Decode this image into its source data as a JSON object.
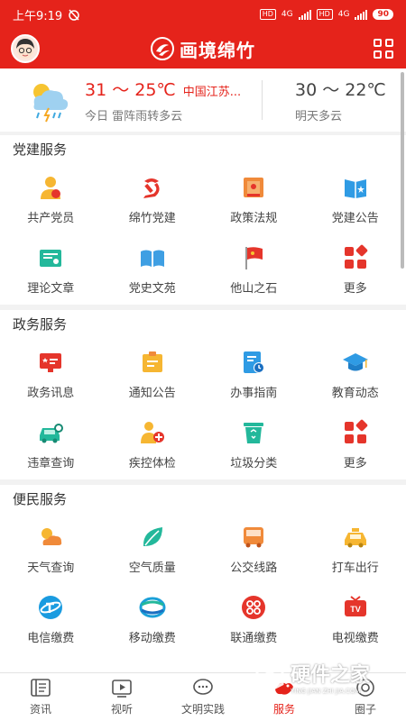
{
  "status_bar": {
    "time": "上午9:19",
    "signal_1": "4G",
    "signal_2": "4G",
    "hd_1": "HD",
    "hd_2": "HD",
    "battery": "90"
  },
  "header": {
    "title": "画境绵竹"
  },
  "weather": {
    "today_temp": "31 ～ 25℃",
    "location": "中国江苏...",
    "today_desc": "今日 雷阵雨转多云",
    "tomorrow_temp": "30 ～ 22℃",
    "tomorrow_desc": "明天多云"
  },
  "sections": [
    {
      "title": "党建服务",
      "items": [
        {
          "label": "共产党员",
          "icon": "party-member-icon"
        },
        {
          "label": "绵竹党建",
          "icon": "party-emblem-icon"
        },
        {
          "label": "政策法规",
          "icon": "law-book-icon"
        },
        {
          "label": "党建公告",
          "icon": "notice-book-icon"
        },
        {
          "label": "理论文章",
          "icon": "certificate-icon"
        },
        {
          "label": "党史文苑",
          "icon": "open-book-icon"
        },
        {
          "label": "他山之石",
          "icon": "red-flag-icon"
        },
        {
          "label": "更多",
          "icon": "more-grid-icon"
        }
      ]
    },
    {
      "title": "政务服务",
      "items": [
        {
          "label": "政务讯息",
          "icon": "monitor-icon"
        },
        {
          "label": "通知公告",
          "icon": "clipboard-icon"
        },
        {
          "label": "办事指南",
          "icon": "guide-clock-icon"
        },
        {
          "label": "教育动态",
          "icon": "graduation-cap-icon"
        },
        {
          "label": "违章查询",
          "icon": "car-search-icon"
        },
        {
          "label": "疾控体检",
          "icon": "health-check-icon"
        },
        {
          "label": "垃圾分类",
          "icon": "recycle-bin-icon"
        },
        {
          "label": "更多",
          "icon": "more-grid-icon"
        }
      ]
    },
    {
      "title": "便民服务",
      "items": [
        {
          "label": "天气查询",
          "icon": "sun-cloud-icon"
        },
        {
          "label": "空气质量",
          "icon": "leaf-icon"
        },
        {
          "label": "公交线路",
          "icon": "bus-icon"
        },
        {
          "label": "打车出行",
          "icon": "taxi-icon"
        },
        {
          "label": "电信缴费",
          "icon": "telecom-icon"
        },
        {
          "label": "移动缴费",
          "icon": "china-mobile-icon"
        },
        {
          "label": "联通缴费",
          "icon": "china-unicom-icon"
        },
        {
          "label": "电视缴费",
          "icon": "tv-icon"
        }
      ]
    }
  ],
  "bottom_nav": [
    {
      "label": "资讯",
      "icon": "news-icon",
      "active": false
    },
    {
      "label": "视听",
      "icon": "video-icon",
      "active": false
    },
    {
      "label": "文明实践",
      "icon": "chat-icon",
      "active": false
    },
    {
      "label": "服务",
      "icon": "service-icon",
      "active": true
    },
    {
      "label": "圈子",
      "icon": "circle-icon",
      "active": false
    }
  ],
  "watermark": {
    "text": "硬件之家",
    "sub": "YING JIAN ZHI JIA.COM"
  },
  "colors": {
    "brand": "#e5231b",
    "background": "#f2f2f2"
  }
}
